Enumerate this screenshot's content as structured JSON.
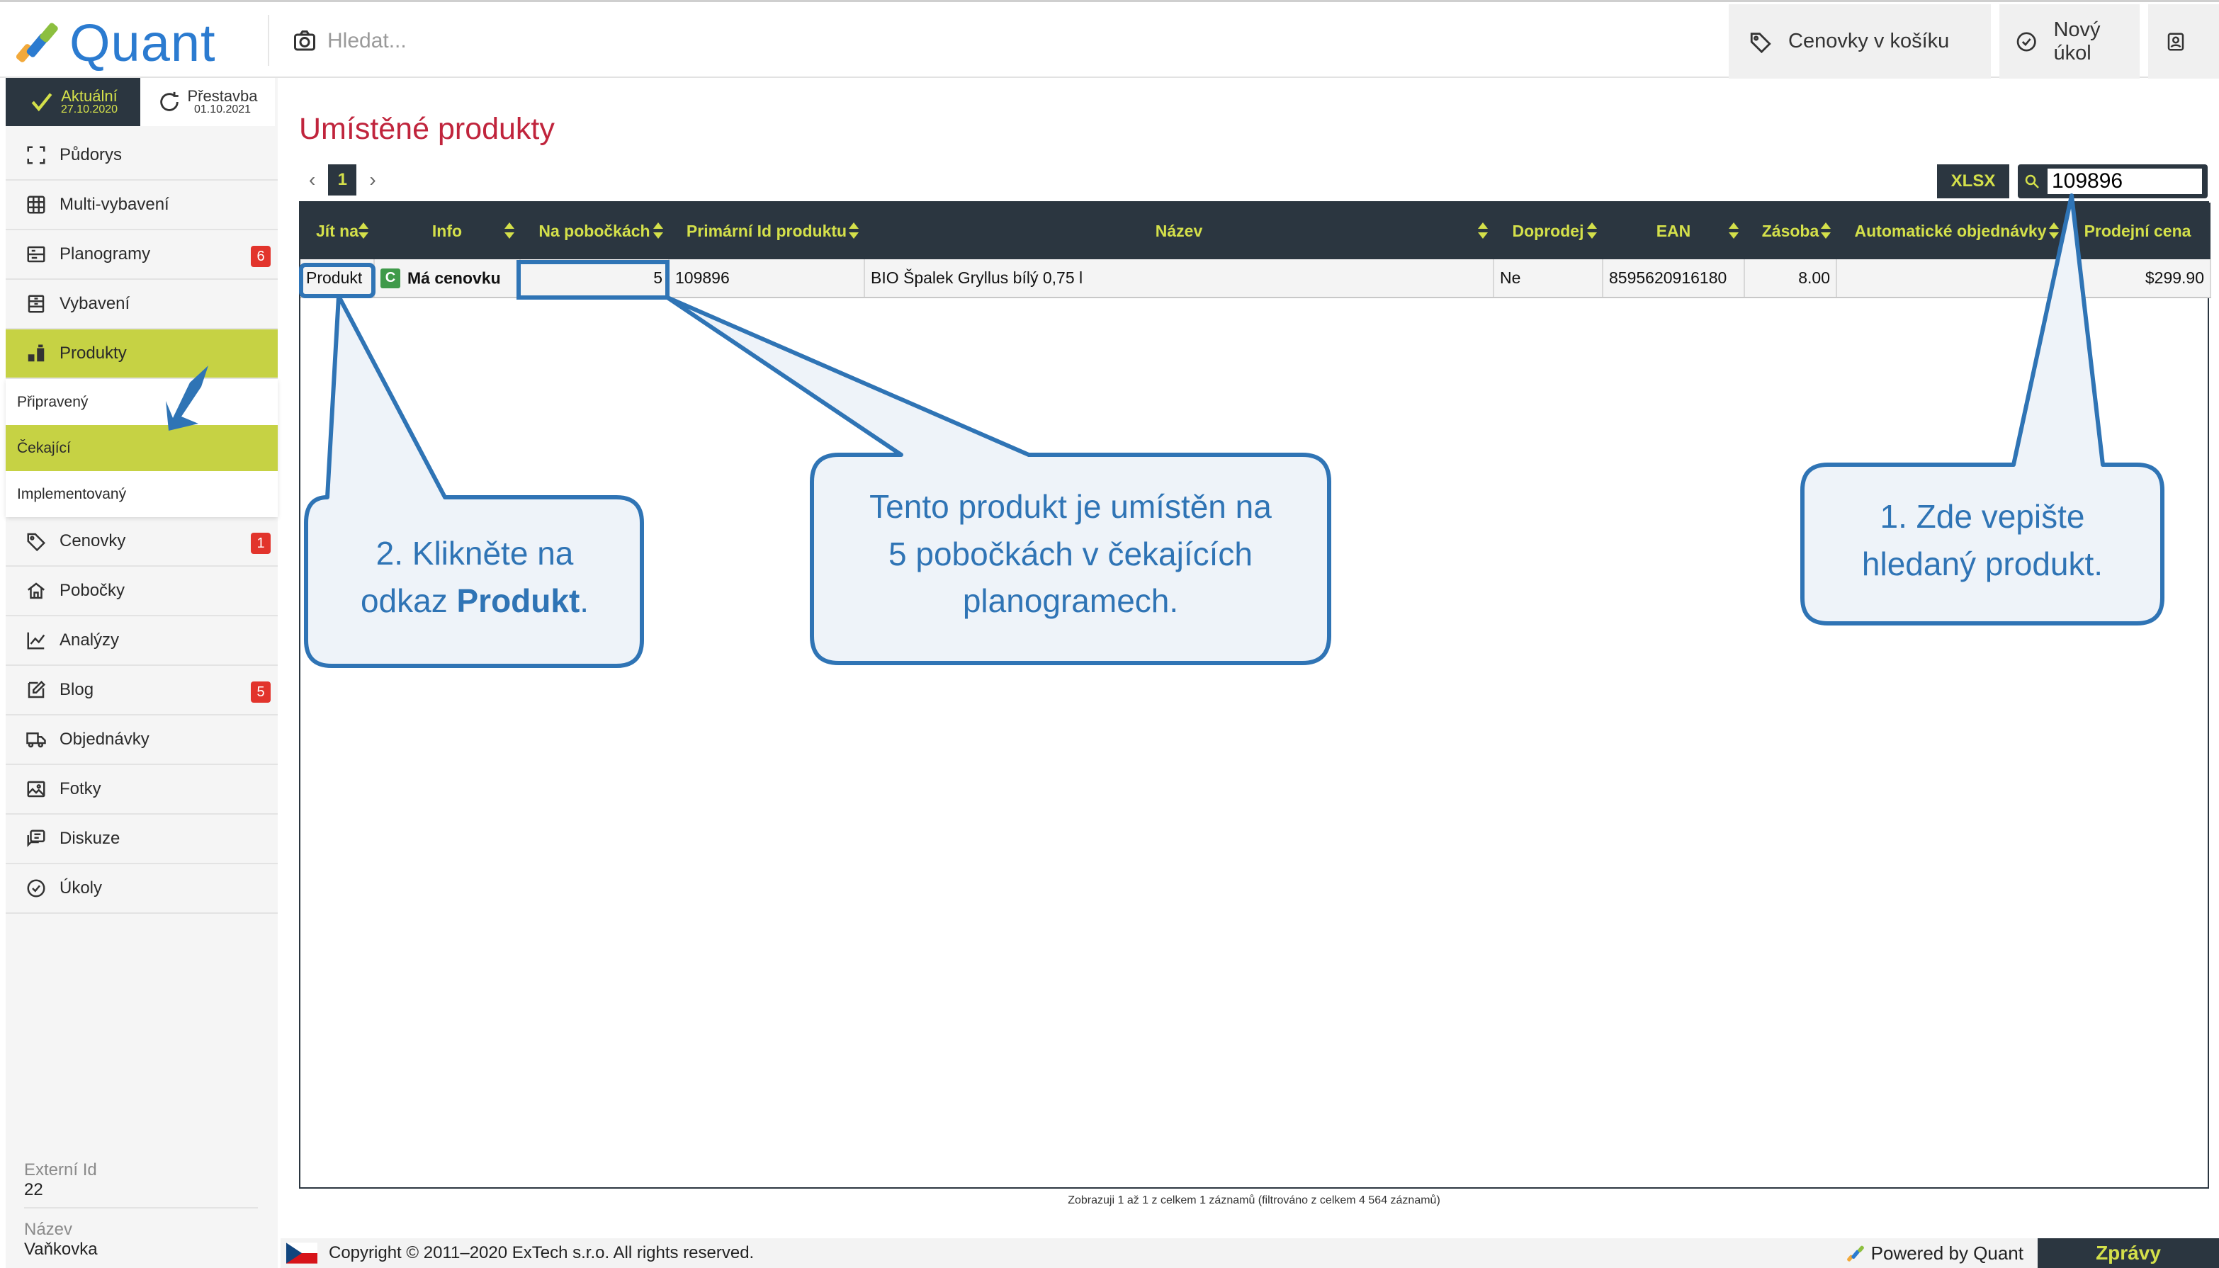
{
  "app": {
    "name": "Quant"
  },
  "topbar": {
    "search_placeholder": "Hledat...",
    "cart_label": "Cenovky v košíku",
    "task_label": "Nový úkol"
  },
  "sidebar": {
    "state_active": {
      "label": "Aktuální",
      "date": "27.10.2020"
    },
    "state_rebuild": {
      "label": "Přestavba",
      "date": "01.10.2021"
    },
    "items": [
      {
        "label": "Půdorys",
        "icon": "floorplan-icon"
      },
      {
        "label": "Multi-vybavení",
        "icon": "grid-icon"
      },
      {
        "label": "Planogramy",
        "icon": "planogram-icon",
        "badge": "6"
      },
      {
        "label": "Vybavení",
        "icon": "shelf-icon"
      },
      {
        "label": "Produkty",
        "icon": "products-icon",
        "active": true
      },
      {
        "label": "Cenovky",
        "icon": "price-tag-icon",
        "badge": "1"
      },
      {
        "label": "Pobočky",
        "icon": "home-icon"
      },
      {
        "label": "Analýzy",
        "icon": "chart-icon"
      },
      {
        "label": "Blog",
        "icon": "edit-icon",
        "badge": "5"
      },
      {
        "label": "Objednávky",
        "icon": "truck-icon"
      },
      {
        "label": "Fotky",
        "icon": "image-icon"
      },
      {
        "label": "Diskuze",
        "icon": "chat-icon"
      },
      {
        "label": "Úkoly",
        "icon": "check-circle-icon"
      }
    ],
    "submenu": [
      {
        "label": "Připravený"
      },
      {
        "label": "Čekající",
        "active": true
      },
      {
        "label": "Implementovaný"
      }
    ],
    "info": [
      {
        "label": "Externí Id",
        "value": "22"
      },
      {
        "label": "Název",
        "value": "Vaňkovka"
      }
    ]
  },
  "main": {
    "title": "Umístěné produkty",
    "pager": {
      "prev": "‹",
      "current": "1",
      "next": "›"
    },
    "export_label": "XLSX",
    "search_value": "109896",
    "columns": [
      "Jít na",
      "Info",
      "Na pobočkách",
      "Primární Id produktu",
      "Název",
      "Doprodej",
      "EAN",
      "Zásoba",
      "Automatické objednávky",
      "Prodejní cena"
    ],
    "rows": [
      {
        "go_to": "Produkt",
        "info_badge": "C",
        "info_text": "Má cenovku",
        "branches": "5",
        "primary_id": "109896",
        "name": "BIO Špalek Gryllus bílý 0,75 l",
        "clearance": "Ne",
        "ean": "8595620916180",
        "stock": "8.00",
        "auto_orders": "",
        "price": "$299.90"
      }
    ],
    "table_info": "Zobrazuji 1 až 1 z celkem 1 záznamů (filtrováno z celkem 4 564 záznamů)"
  },
  "footer": {
    "copyright": "Copyright © 2011–2020 ExTech s.r.o. All rights reserved.",
    "powered": "Powered by Quant",
    "messages": "Zprávy"
  },
  "callouts": {
    "c1_line1": "1. Zde vepište",
    "c1_line2": "hledaný produkt.",
    "c2_line1": "2. Klikněte na",
    "c2_prefix": "odkaz ",
    "c2_bold": "Produkt",
    "c2_suffix": ".",
    "c3_line1": "Tento produkt je umístěn na",
    "c3_line2": "5 pobočkách v čekajících",
    "c3_line3": "planogramech."
  },
  "colors": {
    "dark": "#2b3640",
    "accent": "#d4e04a",
    "active_green": "#c6d244",
    "title_red": "#c0243c",
    "badge_red": "#e2342c",
    "callout_blue": "#2f74b5"
  }
}
